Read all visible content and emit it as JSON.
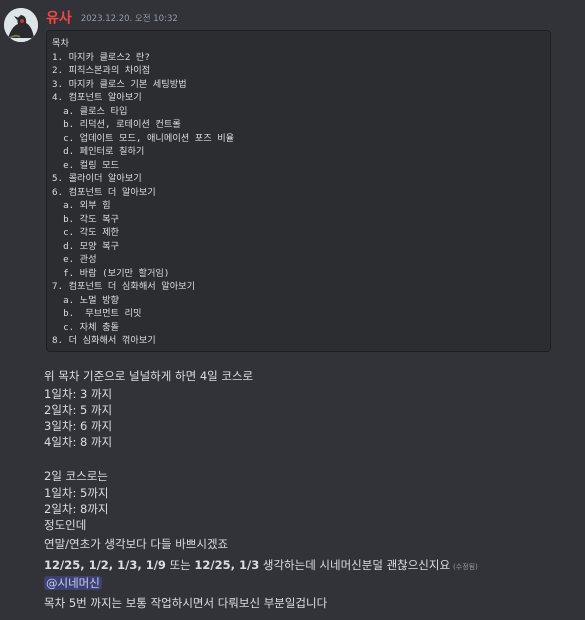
{
  "message": {
    "author": "유사",
    "timestamp": "2023.12.20. 오전 10:32",
    "author_color": "#f04747",
    "code_lines": [
      "목차",
      "1. 마지카 클로스2 란?",
      "2. 피직스본과의 차이점",
      "3. 마지카 클로스 기본 세팅방법",
      "4. 컴포넌트 알아보기",
      "  a. 클로스 타입",
      "  b. 리덕션, 로테이션 컨트롤",
      "  c. 업데이트 모드, 애니메이션 포즈 비율",
      "  d. 페인터로 칠하기",
      "  e. 컬링 모드",
      "5. 콜라이더 알아보기",
      "6. 컴포넌트 더 알아보기",
      "  a. 외부 힘",
      "  b. 각도 복구",
      "  c. 각도 제한",
      "  d. 모양 복구",
      "  e. 관성",
      "  f. 바람 (보기만 할거임)",
      "7. 컴포넌트 더 심화해서 알아보기",
      "  a. 노멀 방향",
      "  b.  무브먼트 리밋",
      "  c. 자체 충돌",
      "8. 더 심화해서 꺾아보기"
    ],
    "lines": {
      "l1": "위 목차 기준으로 널널하게 하면 4일 코스로",
      "l2": "1일차: 3 까지",
      "l3": "2일차: 5 까지",
      "l4": "3일차: 6 까지",
      "l5": "4일차: 8 까지",
      "l6": "2일 코스로는",
      "l7": "1일차: 5까지",
      "l8": "2일차: 8까지",
      "l9": "정도인데",
      "l10": "연말/연초가 생각보다 다들 바쁘시겠죠",
      "l11_bold": "12/25, 1/2, 1/3, 1/9",
      "l11_mid": " 또는 ",
      "l11_bold2": "12/25, 1/3",
      "l11_tail": " 생각하는데 시네머신분덜 괜찮으신지요",
      "l11_edited": "(수정됨)",
      "mention": "@시네머신",
      "l13": "목차 5번 까지는 보통 작업하시면서 다뤄보신 부분일겁니다"
    }
  }
}
